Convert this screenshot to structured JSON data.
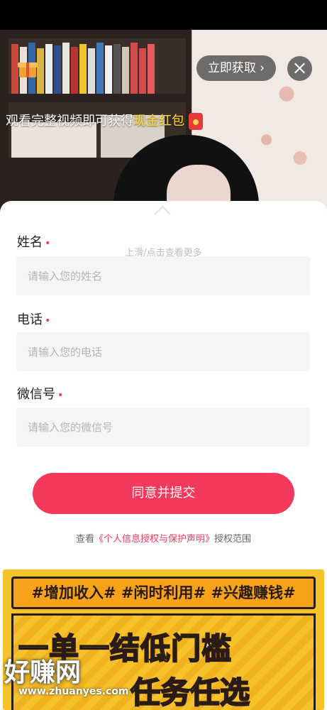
{
  "video": {
    "get_button_label": "立即获取 ›",
    "banner_prefix": "观看完整视频即可获得",
    "banner_highlight": "现金红包"
  },
  "sheet": {
    "hint": "上滑/点击查看更多",
    "fields": [
      {
        "label": "姓名",
        "placeholder": "请输入您的姓名"
      },
      {
        "label": "电话",
        "placeholder": "请输入您的电话"
      },
      {
        "label": "微信号",
        "placeholder": "请输入您的微信号"
      }
    ],
    "required_mark": "•",
    "submit_label": "同意并提交",
    "consent_prefix": "查看",
    "consent_link": "《个人信息授权与保护声明》",
    "consent_suffix": "授权范围"
  },
  "promo": {
    "tags": "#增加收入# #闲时利用# #兴趣赚钱#",
    "headline1": "一单一结低门槛",
    "headline2": "任务任选"
  },
  "watermark": {
    "logo_text": "好赚网",
    "url": "www.zhuanyes.com"
  },
  "colors": {
    "accent": "#f5395c",
    "highlight": "#ffd93a",
    "promo_bg": "#f6c22b"
  }
}
